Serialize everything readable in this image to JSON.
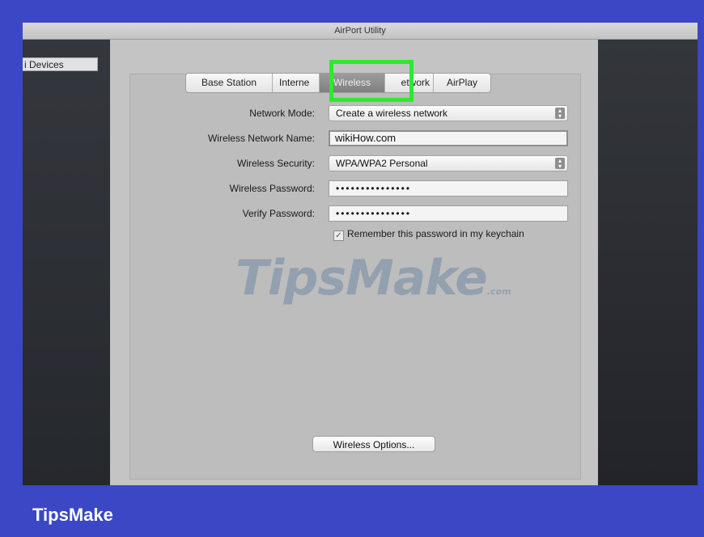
{
  "window": {
    "title": "AirPort Utility"
  },
  "sidebar": {
    "devices_label": "i Devices"
  },
  "tabs": [
    {
      "label": "Base Station",
      "selected": false
    },
    {
      "label": "Interne",
      "selected": false
    },
    {
      "label": "Wireless",
      "selected": true
    },
    {
      "label": "etwork",
      "selected": false
    },
    {
      "label": "AirPlay",
      "selected": false
    }
  ],
  "form": {
    "network_mode": {
      "label": "Network Mode:",
      "value": "Create a wireless network"
    },
    "network_name": {
      "label": "Wireless Network Name:",
      "value": "wikiHow.com"
    },
    "security": {
      "label": "Wireless Security:",
      "value": "WPA/WPA2 Personal"
    },
    "password": {
      "label": "Wireless Password:",
      "value": "•••••••••••••••"
    },
    "verify": {
      "label": "Verify Password:",
      "value": "•••••••••••••••"
    },
    "remember": {
      "label": "Remember this password in my keychain",
      "checked": true
    }
  },
  "options_button": "Wireless Options...",
  "watermark": {
    "text": "TipsMake",
    "suffix": ".com"
  },
  "footer": {
    "brand": "TipsMake"
  },
  "colors": {
    "frame": "#3b47c4",
    "highlight": "#2fe82f"
  }
}
